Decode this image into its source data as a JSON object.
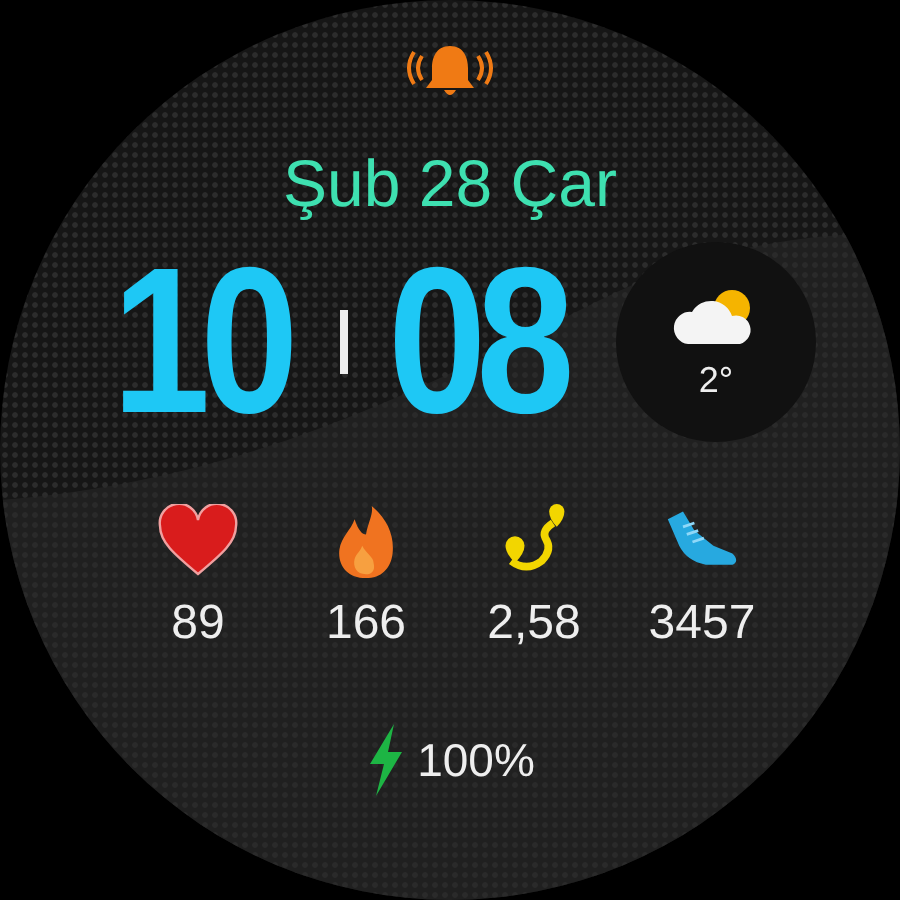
{
  "date": "Şub 28 Çar",
  "time": {
    "hours": "10",
    "minutes": "08"
  },
  "weather": {
    "temperature": "2°"
  },
  "stats": [
    {
      "kind": "heart",
      "value": "89"
    },
    {
      "kind": "calories",
      "value": "166"
    },
    {
      "kind": "distance",
      "value": "2,58"
    },
    {
      "kind": "steps",
      "value": "3457"
    }
  ],
  "battery": {
    "value": "100%"
  }
}
